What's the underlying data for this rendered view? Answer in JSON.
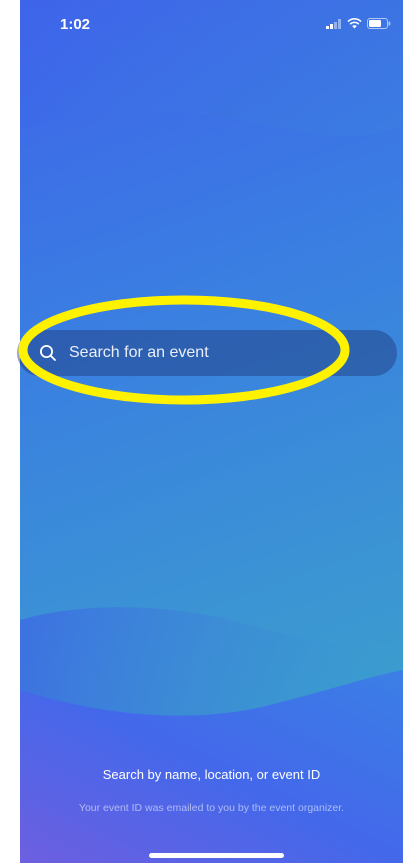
{
  "status_bar": {
    "time": "1:02",
    "icons": [
      "cellular-signal-icon",
      "wifi-icon",
      "battery-icon"
    ]
  },
  "search": {
    "placeholder": "Search for an event",
    "icon": "search-icon"
  },
  "hints": {
    "primary": "Search by name, location, or event ID",
    "secondary": "Your event ID was emailed to you by the event organizer."
  },
  "colors": {
    "gradient_start": "#3f63ea",
    "gradient_end": "#3aa5c8",
    "highlight": "#fff200"
  }
}
